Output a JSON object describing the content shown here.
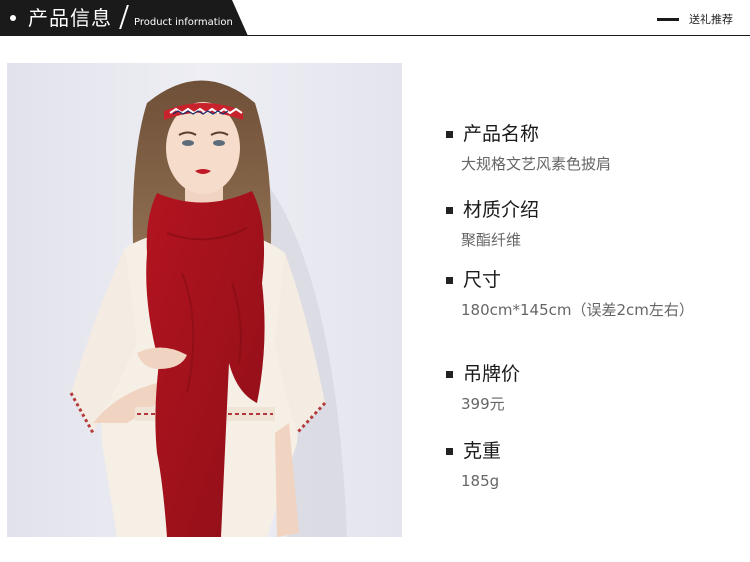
{
  "header": {
    "title": "产品信息",
    "subtitle": "Product information",
    "gift_label": "送礼推荐"
  },
  "photo": {
    "alt": "model wearing red shawl",
    "colors": {
      "background": "#e8e8f0",
      "scarf": "#a5121c",
      "dress": "#f6efe6",
      "hair": "#8a6a4c"
    }
  },
  "product": [
    {
      "label": "产品名称",
      "value": "大规格文艺风素色披肩"
    },
    {
      "label": "材质介绍",
      "value": "聚酯纤维"
    },
    {
      "label": "尺寸",
      "value": "180cm*145cm（误差2cm左右）"
    },
    {
      "label": "吊牌价",
      "value": "399元"
    },
    {
      "label": "克重",
      "value": "185g"
    }
  ]
}
